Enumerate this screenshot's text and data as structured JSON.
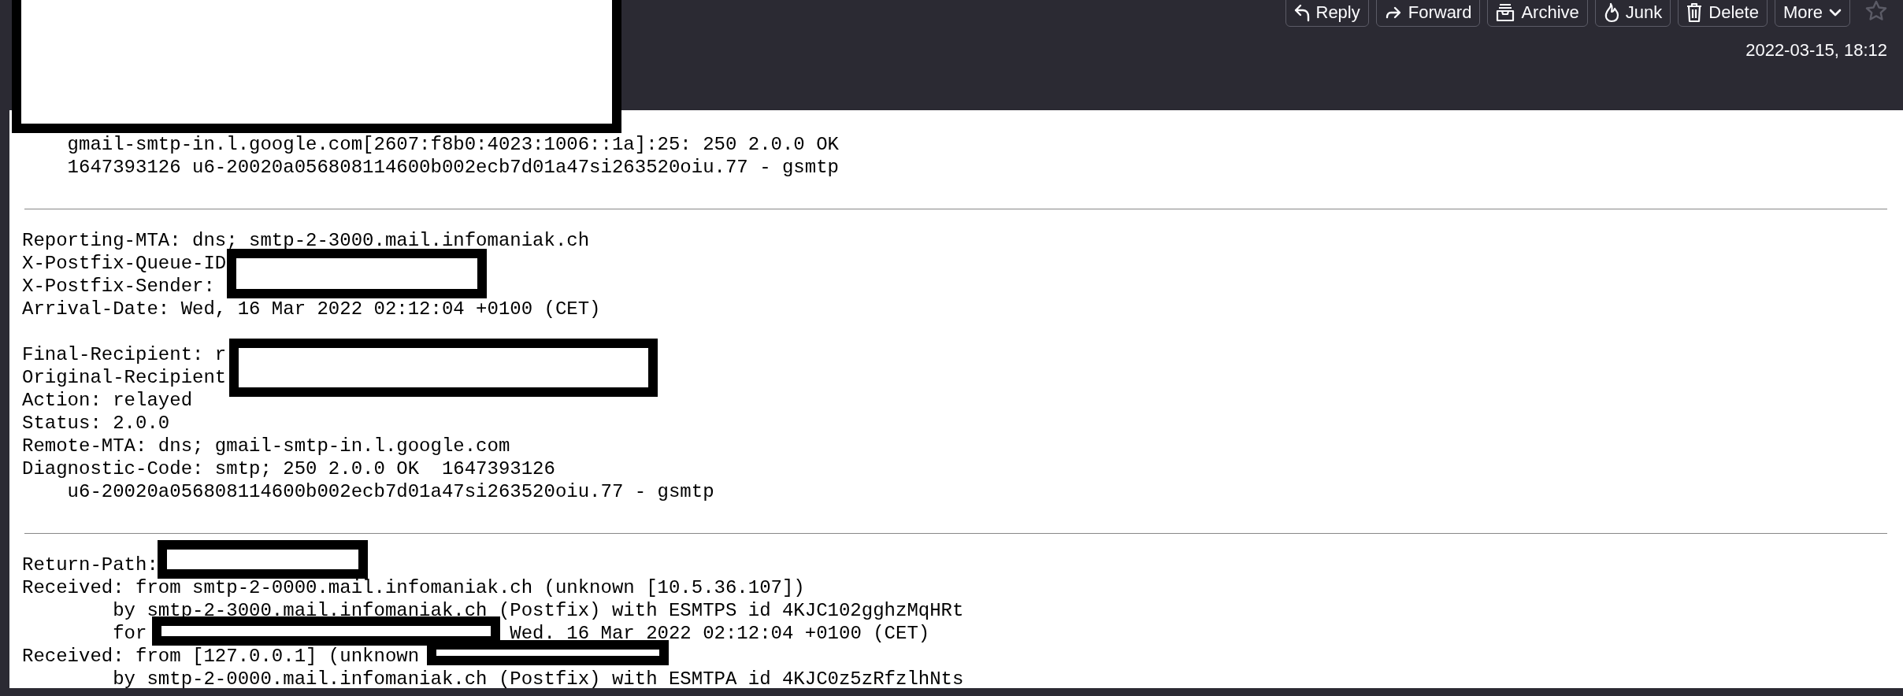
{
  "toolbar": {
    "buttons": [
      {
        "label": "Reply",
        "kind": "reply"
      },
      {
        "label": "Forward",
        "kind": "forward"
      },
      {
        "label": "Archive",
        "kind": "archive"
      },
      {
        "label": "Junk",
        "kind": "junk"
      },
      {
        "label": "Delete",
        "kind": "delete"
      },
      {
        "label": "More",
        "kind": "more"
      }
    ],
    "starred": false
  },
  "date": "2022-03-15, 18:12",
  "sections": [
    {
      "paragraphs": [
        [
          "    gmail-smtp-in.l.google.com[2607:f8b0:4023:1006::1a]:25: 250 2.0.0 OK",
          "    1647393126 u6-20020a056808114600b002ecb7d01a47si263520oiu.77 - gsmtp"
        ]
      ]
    },
    {
      "paragraphs": [
        [
          "Reporting-MTA: dns; smtp-2-3000.mail.infomaniak.ch",
          "X-Postfix-Queue-ID",
          "X-Postfix-Sender:",
          "Arrival-Date: Wed, 16 Mar 2022 02:12:04 +0100 (CET)"
        ],
        [
          "Final-Recipient: r",
          "Original-Recipient",
          "Action: relayed",
          "Status: 2.0.0",
          "Remote-MTA: dns; gmail-smtp-in.l.google.com",
          "Diagnostic-Code: smtp; 250 2.0.0 OK  1647393126",
          "    u6-20020a056808114600b002ecb7d01a47si263520oiu.77 - gsmtp"
        ]
      ]
    },
    {
      "paragraphs": [
        [
          "Return-Path:",
          "Received: from smtp-2-0000.mail.infomaniak.ch (unknown [10.5.36.107])",
          "        by smtp-2-3000.mail.infomaniak.ch (Postfix) with ESMTPS id 4KJC102gghzMqHRt",
          [
            "        for",
            "Wed. 16 Mar 2022 02:12:04 +0100 (CET)"
          ],
          "Received: from [127.0.0.1] (unknown",
          "        by smtp-2-0000.mail.infomaniak.ch (Postfix) with ESMTPA id 4KJC0z5zRfzlhNts"
        ]
      ]
    }
  ]
}
